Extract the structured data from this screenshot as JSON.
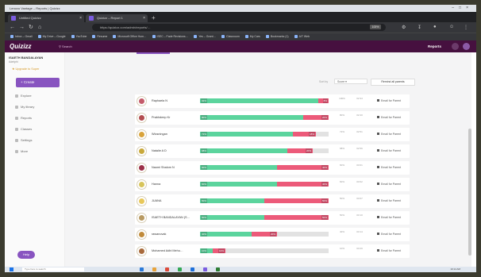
{
  "window": {
    "title": "Lenovo Vantage – Reports | Quizizz"
  },
  "browser": {
    "tabs": [
      {
        "label": "Untitled Quizizz"
      },
      {
        "label": "Quizizz – Report 1"
      }
    ],
    "address": "https://quizizz.com/admin/reports/…",
    "address_badge": "100%",
    "bookmarks": [
      "Inbox – Gmail",
      "My Drive – Google",
      "YouTube",
      "Resume",
      "Microsoft Office Hom…",
      "ISEC – Fade Revisions…",
      "Yes – Grant…",
      "Classroom",
      "My Cars",
      "Bookmarks (1)",
      "A/T Web"
    ]
  },
  "app": {
    "logo": "Quizizz",
    "search_placeholder": "Search",
    "reports_link": "Reports"
  },
  "sidebar": {
    "user_name": "ISAETH BANDALAYAN",
    "user_class": "Adelphi",
    "upgrade": "Upgrade to Super",
    "create_label": "Create",
    "nav": [
      "Explore",
      "My library",
      "Reports",
      "Classes",
      "Settings",
      "More"
    ],
    "help": "Help"
  },
  "toolbar": {
    "sort_label": "Sort by",
    "sort_value": "Score",
    "remind_all": "Remind all parents"
  },
  "participants": [
    {
      "name": "Raphaela N",
      "correct": 0.92,
      "incorrect": 0.08,
      "correct_lbl": "92%",
      "incorrect_lbl": "8%",
      "avatar": "#c45b6a",
      "s1": "100%",
      "s2": "02:34",
      "remind": "Email for Parent"
    },
    {
      "name": "Prabhdeep Kr",
      "correct": 0.8,
      "incorrect": 0.2,
      "correct_lbl": "80%",
      "incorrect_lbl": "20%",
      "avatar": "#b34d50",
      "s1": "80%",
      "s2": "02:40",
      "remind": "Email for Parent"
    },
    {
      "name": "Wiosningan",
      "correct": 0.72,
      "incorrect": 0.18,
      "correct_lbl": "72%",
      "incorrect_lbl": "18%",
      "avatar": "#d9a33a",
      "s1": "72%",
      "s2": "02:51",
      "remind": "Email for Parent"
    },
    {
      "name": "Natalie A D",
      "correct": 0.68,
      "incorrect": 0.2,
      "correct_lbl": "68%",
      "incorrect_lbl": "20%",
      "avatar": "#c9a93b",
      "s1": "68%",
      "s2": "02:56",
      "remind": "Email for Parent"
    },
    {
      "name": "Naomi Shalom N",
      "correct": 0.6,
      "incorrect": 0.4,
      "correct_lbl": "60%",
      "incorrect_lbl": "40%",
      "avatar": "#9c3048",
      "s1": "60%",
      "s2": "03:01",
      "remind": "Email for Parent"
    },
    {
      "name": "Hanna",
      "correct": 0.6,
      "incorrect": 0.4,
      "correct_lbl": "60%",
      "incorrect_lbl": "40%",
      "avatar": "#d7c45a",
      "s1": "60%",
      "s2": "03:02",
      "remind": "Email for Parent"
    },
    {
      "name": "JUANA",
      "correct": 0.5,
      "incorrect": 0.5,
      "correct_lbl": "50%",
      "incorrect_lbl": "50%",
      "avatar": "#e8c85a",
      "s1": "50%",
      "s2": "03:07",
      "remind": "Email for Parent"
    },
    {
      "name": "ISAETH BANDALAYAN (S…",
      "correct": 0.5,
      "incorrect": 0.5,
      "correct_lbl": "50%",
      "incorrect_lbl": "50%",
      "avatar": "#b89a62",
      "s1": "50%",
      "s2": "03:10",
      "remind": "Email for Parent"
    },
    {
      "name": "rawanovak",
      "correct": 0.4,
      "incorrect": 0.2,
      "correct_lbl": "40%",
      "incorrect_lbl": "20%",
      "avatar": "#c08a3a",
      "s1": "40%",
      "s2": "03:14",
      "remind": "Email for Parent"
    },
    {
      "name": "Mohamed Adbl Mehu…",
      "correct": 0.1,
      "incorrect": 0.1,
      "correct_lbl": "10%",
      "incorrect_lbl": "10%",
      "avatar": "#a86a3c",
      "s1": "10%",
      "s2": "03:20",
      "remind": "Email for Parent"
    }
  ],
  "taskbar": {
    "search_placeholder": "Type here to search",
    "clock": "10:14 AM"
  },
  "colors": {
    "correct": "#5bd49d",
    "incorrect": "#ec5a79",
    "brand": "#8854c0",
    "header": "#46103f"
  }
}
